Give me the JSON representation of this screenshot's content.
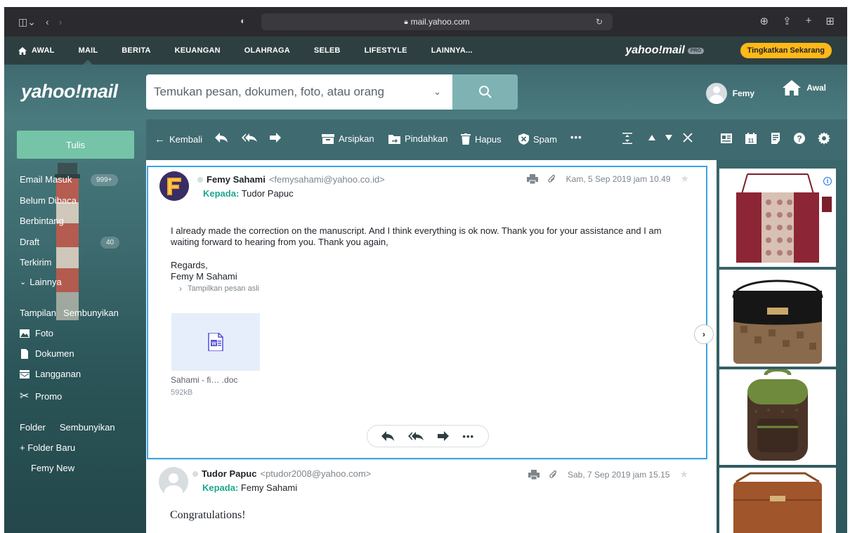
{
  "browser": {
    "url": "mail.yahoo.com"
  },
  "topnav": {
    "items": [
      "AWAL",
      "MAIL",
      "BERITA",
      "KEUANGAN",
      "OLAHRAGA",
      "SELEB",
      "LIFESTYLE",
      "LAINNYA..."
    ],
    "active": "MAIL",
    "brand": "yahoo!mail",
    "brand_badge": "PRO",
    "upgrade_label": "Tingkatkan Sekarang"
  },
  "header": {
    "logo": "yahoo!mail",
    "search_placeholder": "Temukan pesan, dokumen, foto, atau orang",
    "user_name": "Femy",
    "home_label": "Awal"
  },
  "sidebar": {
    "compose_label": "Tulis",
    "folders": [
      {
        "label": "Email Masuk",
        "badge": "999+"
      },
      {
        "label": "Belum Dibaca",
        "badge": ""
      },
      {
        "label": "Berbintang",
        "badge": ""
      },
      {
        "label": "Draft",
        "badge": "40"
      },
      {
        "label": "Terkirim",
        "badge": ""
      },
      {
        "label": "Lainnya",
        "badge": ""
      }
    ],
    "views_heading": "Tampilan",
    "views_toggle": "Sembunyikan",
    "views": [
      {
        "label": "Foto",
        "icon": "photo-icon"
      },
      {
        "label": "Dokumen",
        "icon": "document-icon"
      },
      {
        "label": "Langganan",
        "icon": "subscription-icon"
      },
      {
        "label": "Promo",
        "icon": "scissors-icon"
      }
    ],
    "folders_heading": "Folder",
    "folders_toggle": "Sembunyikan",
    "new_folder_label": "+ Folder Baru",
    "custom_folders": [
      "Femy New"
    ]
  },
  "toolbar": {
    "back_label": "Kembali",
    "archive_label": "Arsipkan",
    "move_label": "Pindahkan",
    "delete_label": "Hapus",
    "spam_label": "Spam",
    "more_label": "•••"
  },
  "messages": [
    {
      "sender_name": "Femy Sahami",
      "sender_email": "<femysahami@yahoo.co.id>",
      "to_label": "Kepada:",
      "to_name": "Tudor Papuc",
      "date": "Kam, 5 Sep 2019 jam 10.49",
      "body_lines": [
        "I already made the correction on the manuscript. And I think everything is ok now. Thank you for your assistance and I am waiting forward to hearing from you. Thank you again,"
      ],
      "closing": "Regards,",
      "signature": "Femy M Sahami",
      "show_original": "Tampilkan pesan asli",
      "attachment": {
        "name": "Sahami - fi… .doc",
        "size": "592kB"
      }
    },
    {
      "sender_name": "Tudor Papuc",
      "sender_email": "<ptudor2008@yahoo.com>",
      "to_label": "Kepada:",
      "to_name": "Femy Sahami",
      "date": "Sab, 7 Sep 2019 jam 15.15",
      "body_start": "Congratulations!"
    }
  ],
  "colors": {
    "nav_bg": "#2e3f41",
    "teal": "#3f6a70",
    "compose": "#75c4a8",
    "upgrade": "#ffb818",
    "selected_border": "#39a4e8",
    "to_label": "#1ba78c"
  }
}
